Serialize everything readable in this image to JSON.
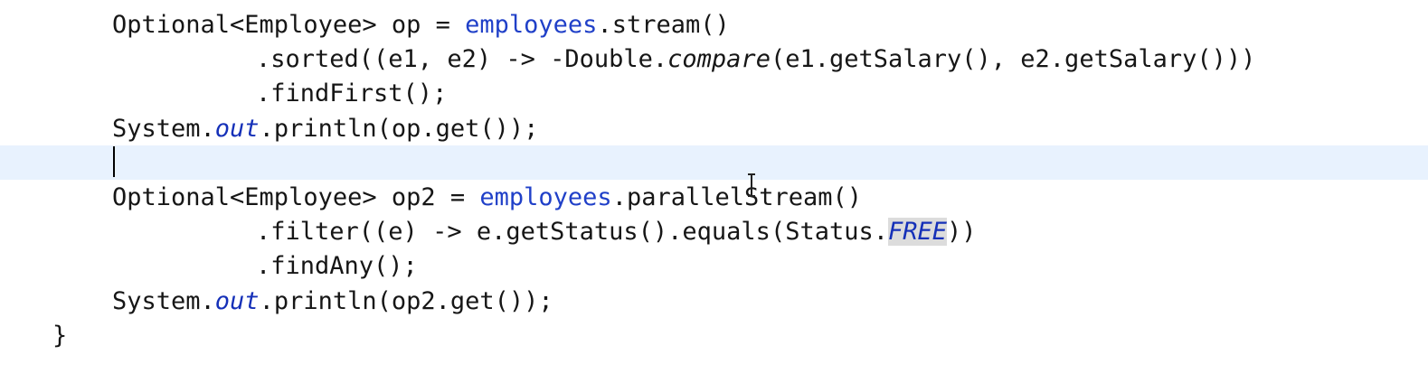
{
  "editor": {
    "lines": [
      {
        "indent": 124,
        "tokens": [
          {
            "t": "Optional<Employee> op = "
          },
          {
            "t": "employees",
            "c": "field"
          },
          {
            "t": ".stream()"
          }
        ]
      },
      {
        "indent": 283,
        "tokens": [
          {
            "t": ".sorted((e1, e2) -> -Double."
          },
          {
            "t": "compare",
            "c": "static-method"
          },
          {
            "t": "(e1.getSalary(), e2.getSalary()))"
          }
        ]
      },
      {
        "indent": 283,
        "tokens": [
          {
            "t": ".findFirst();"
          }
        ]
      },
      {
        "indent": 124,
        "tokens": [
          {
            "t": "System."
          },
          {
            "t": "out",
            "c": "static-field"
          },
          {
            "t": ".println(op.get());"
          }
        ]
      },
      {
        "indent": 124,
        "current": true,
        "tokens": []
      },
      {
        "indent": 124,
        "tokens": [
          {
            "t": "Optional<Employee> op2 = "
          },
          {
            "t": "employees",
            "c": "field"
          },
          {
            "t": ".parallelStream()"
          }
        ]
      },
      {
        "indent": 283,
        "tokens": [
          {
            "t": ".filter((e) -> e.getStatus().equals(Status."
          },
          {
            "t": "FREE",
            "c": "enum-const"
          },
          {
            "t": "))"
          }
        ]
      },
      {
        "indent": 283,
        "tokens": [
          {
            "t": ".findAny();"
          }
        ]
      },
      {
        "indent": 124,
        "tokens": [
          {
            "t": "System."
          },
          {
            "t": "out",
            "c": "static-field"
          },
          {
            "t": ".println(op2.get());"
          }
        ]
      },
      {
        "indent": 58,
        "tokens": [
          {
            "t": "}"
          }
        ]
      }
    ]
  },
  "colors": {
    "field": "#2040c8",
    "static_field": "#1530b8",
    "current_line": "#e8f2fe",
    "occurrence_highlight": "#dcdcdc"
  },
  "cursor_icon": "text-ibeam-icon"
}
